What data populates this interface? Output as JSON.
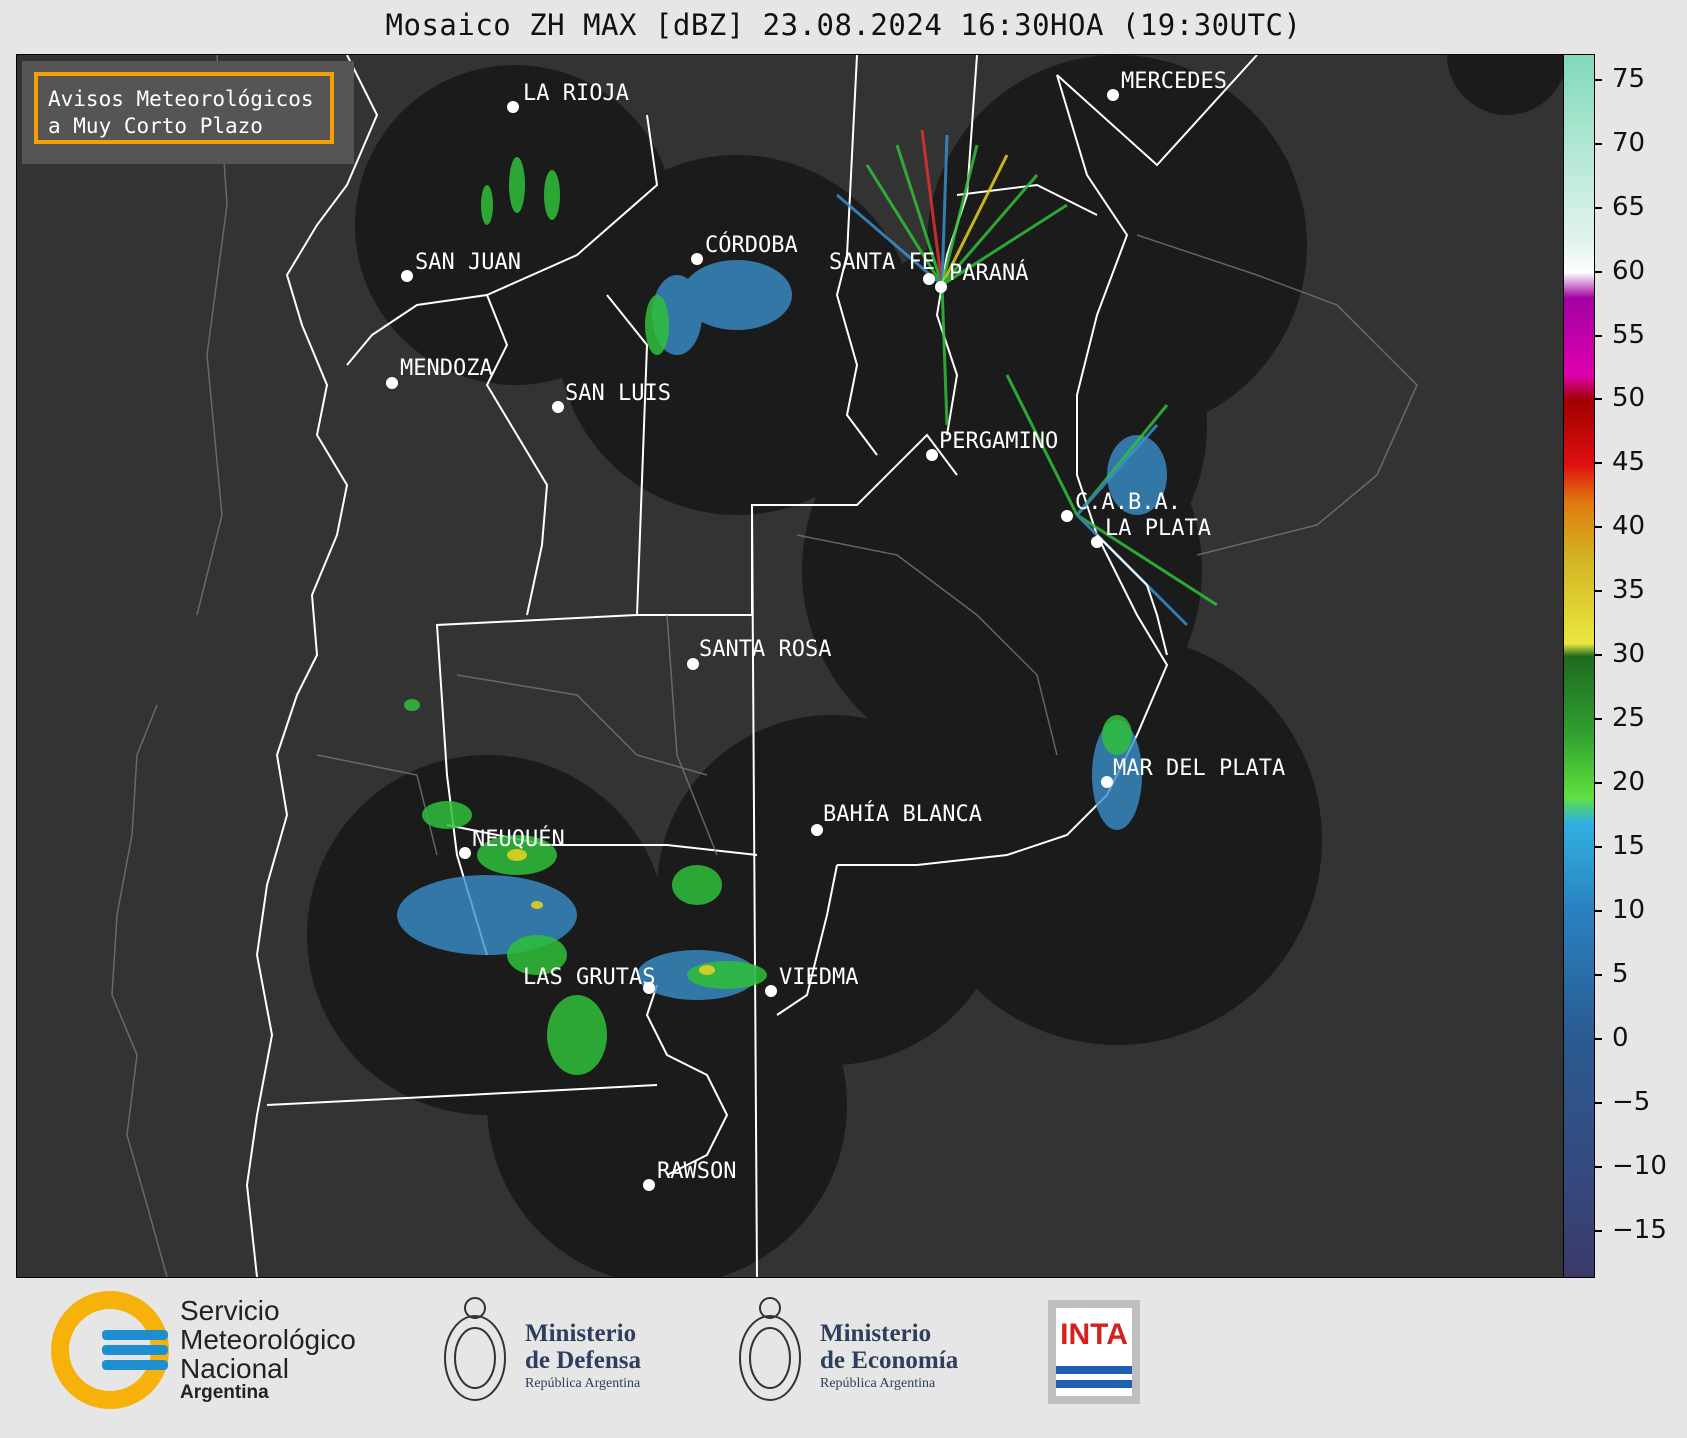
{
  "title": "Mosaico ZH MAX [dBZ] 23.08.2024 16:30HOA (19:30UTC)",
  "notice": {
    "line1": "Avisos Meteorológicos",
    "line2": "a Muy Corto Plazo",
    "border_color": "#f5a000"
  },
  "cities": [
    {
      "name": "LA RIOJA"
    },
    {
      "name": "MERCEDES"
    },
    {
      "name": "SAN JUAN"
    },
    {
      "name": "CÓRDOBA"
    },
    {
      "name": "SANTA FE"
    },
    {
      "name": "PARANÁ"
    },
    {
      "name": "MENDOZA"
    },
    {
      "name": "SAN LUIS"
    },
    {
      "name": "PERGAMINO"
    },
    {
      "name": "C.A.B.A."
    },
    {
      "name": "LA PLATA"
    },
    {
      "name": "SANTA ROSA"
    },
    {
      "name": "MAR DEL PLATA"
    },
    {
      "name": "BAHÍA BLANCA"
    },
    {
      "name": "NEUQUÉN"
    },
    {
      "name": "LAS GRUTAS"
    },
    {
      "name": "VIEDMA"
    },
    {
      "name": "RAWSON"
    }
  ],
  "colorbar": {
    "min": -18.5,
    "max": 77,
    "ticks": [
      "75",
      "70",
      "65",
      "60",
      "55",
      "50",
      "45",
      "40",
      "35",
      "30",
      "25",
      "20",
      "15",
      "10",
      "5",
      "0",
      "−5",
      "−10",
      "−15"
    ],
    "tick_values": [
      75,
      70,
      65,
      60,
      55,
      50,
      45,
      40,
      35,
      30,
      25,
      20,
      15,
      10,
      5,
      0,
      -5,
      -10,
      -15
    ]
  },
  "footer": {
    "smn_line1": "Servicio",
    "smn_line2": "Meteorológico",
    "smn_line3": "Nacional",
    "smn_line4": "Argentina",
    "defensa_line1": "Ministerio",
    "defensa_line2": "de Defensa",
    "defensa_line3": "República Argentina",
    "economia_line1": "Ministerio",
    "economia_line2": "de Economía",
    "economia_line3": "República Argentina",
    "inta": "INTA"
  }
}
